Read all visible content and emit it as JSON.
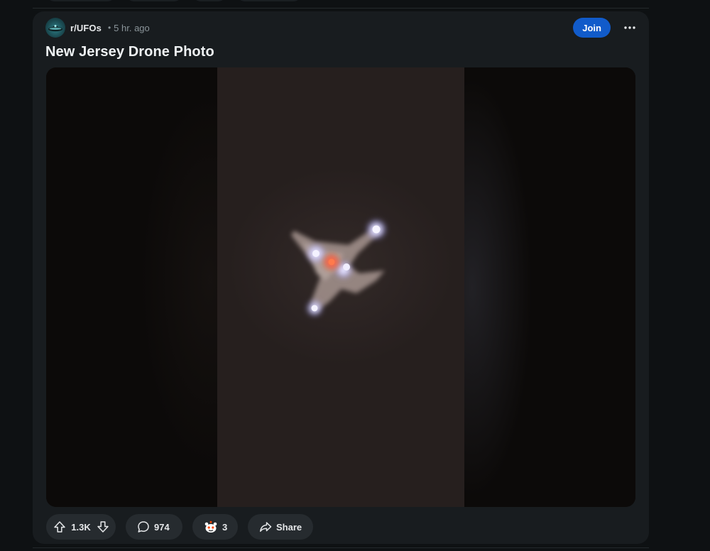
{
  "post": {
    "subreddit": "r/UFOs",
    "separator": "•",
    "time": "5 hr. ago",
    "title": "New Jersey Drone Photo",
    "join_label": "Join",
    "image_alt": "Night sky photo of an aircraft-shaped object with white lights and a red center light"
  },
  "actions": {
    "vote_count": "1.3K",
    "comment_count": "974",
    "award_count": "3",
    "share_label": "Share"
  },
  "icons": {
    "subreddit": "ufo-icon",
    "more": "ellipsis-icon",
    "upvote": "arrow-up-icon",
    "downvote": "arrow-down-icon",
    "comment": "speech-bubble-icon",
    "award": "award-icon",
    "share": "share-icon"
  },
  "colors": {
    "background": "#0e1113",
    "card": "#181c1f",
    "pill": "#262b2f",
    "join": "#115bca",
    "text": "#e6e8ea",
    "muted": "#8a9499"
  }
}
